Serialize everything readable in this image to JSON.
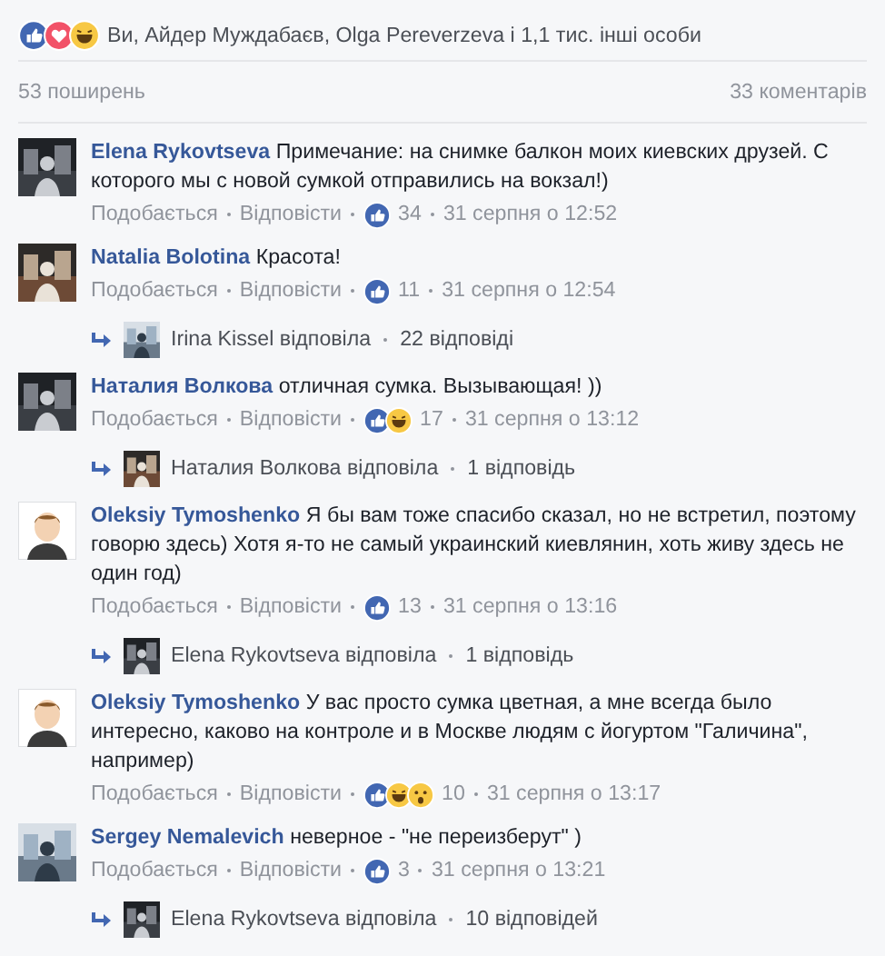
{
  "reactions_summary": {
    "reactions": [
      {
        "kind": "like"
      },
      {
        "kind": "love"
      },
      {
        "kind": "haha"
      }
    ],
    "text": "Ви, Айдер Муждабаєв, Olga Pereverzeva і 1,1 тис. інші особи"
  },
  "shares": "53 поширень",
  "comments_count": "33 коментарів",
  "comments": [
    {
      "author": "Elena Rykovtseva",
      "avatar": {
        "kind": "picture"
      },
      "text": "Примечание: на снимке балкон моих киевских друзей. С которого мы с новой сумкой отправились на вокзал!)",
      "like_action": "Подобається",
      "reply_action": "Відповісти",
      "reactions": [
        {
          "kind": "like"
        }
      ],
      "reaction_count": "34",
      "time": "31 серпня о 12:52"
    },
    {
      "author": "Natalia Bolotina",
      "avatar": {
        "kind": "picture"
      },
      "text": "Красота!",
      "like_action": "Подобається",
      "reply_action": "Відповісти",
      "reactions": [
        {
          "kind": "like"
        }
      ],
      "reaction_count": "11",
      "time": "31 серпня о 12:54",
      "replies": {
        "avatar": {
          "kind": "picture"
        },
        "text": "Irina Kissel відповіла",
        "count": "22 відповіді"
      }
    },
    {
      "author": "Наталия Волкова",
      "avatar": {
        "kind": "picture"
      },
      "text": "отличная сумка. Вызывающая! ))",
      "like_action": "Подобається",
      "reply_action": "Відповісти",
      "reactions": [
        {
          "kind": "like"
        },
        {
          "kind": "haha"
        }
      ],
      "reaction_count": "17",
      "time": "31 серпня о 13:12",
      "replies": {
        "avatar": {
          "kind": "picture"
        },
        "text": "Наталия Волкова відповіла",
        "count": "1 відповідь"
      }
    },
    {
      "author": "Oleksiy Tymoshenko",
      "avatar": {
        "kind": "drawing"
      },
      "text": "Я бы вам тоже спасибо сказал, но не встретил, поэтому говорю здесь) Хотя я-то не самый украинский киевлянин, хоть живу здесь не один год)",
      "like_action": "Подобається",
      "reply_action": "Відповісти",
      "reactions": [
        {
          "kind": "like"
        }
      ],
      "reaction_count": "13",
      "time": "31 серпня о 13:16",
      "replies": {
        "avatar": {
          "kind": "picture"
        },
        "text": "Elena Rykovtseva відповіла",
        "count": "1 відповідь"
      }
    },
    {
      "author": "Oleksiy Tymoshenko",
      "avatar": {
        "kind": "drawing"
      },
      "text": "У вас просто сумка цветная, а мне всегда было интересно, каково на контроле и в Москве людям с йогуртом \"Галичина\", например)",
      "like_action": "Подобається",
      "reply_action": "Відповісти",
      "reactions": [
        {
          "kind": "like"
        },
        {
          "kind": "haha"
        },
        {
          "kind": "wow"
        }
      ],
      "reaction_count": "10",
      "time": "31 серпня о 13:17"
    },
    {
      "author": "Sergey Nemalevich",
      "avatar": {
        "kind": "picture"
      },
      "text": "неверное - \"не переизберут\" )",
      "like_action": "Подобається",
      "reply_action": "Відповісти",
      "reactions": [
        {
          "kind": "like"
        }
      ],
      "reaction_count": "3",
      "time": "31 серпня о 13:21",
      "replies": {
        "avatar": {
          "kind": "picture"
        },
        "text": "Elena Rykovtseva відповіла",
        "count": "10 відповідей"
      }
    }
  ]
}
